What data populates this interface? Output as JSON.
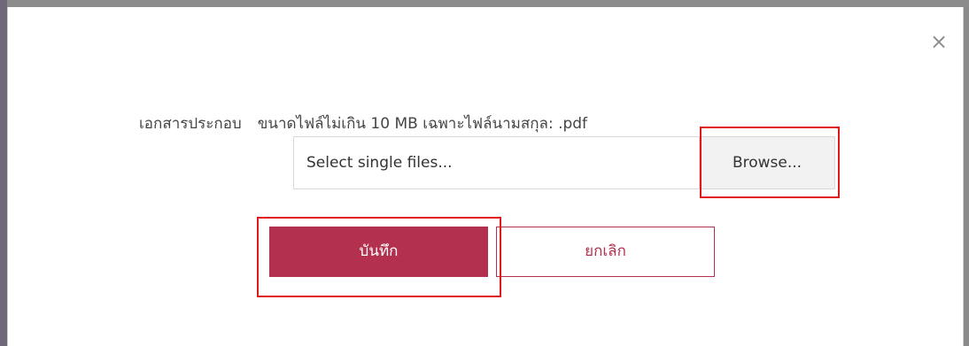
{
  "dialog": {
    "close_icon": "close-icon",
    "close_glyph": "×"
  },
  "upload": {
    "label": "เอกสารประกอบ",
    "hint": "ขนาดไฟล์ไม่เกิน 10 MB เฉพาะไฟล์นามสกุล: .pdf",
    "input_placeholder": "Select single files...",
    "browse_label": "Browse..."
  },
  "actions": {
    "save_label": "บันทึก",
    "cancel_label": "ยกเลิก"
  },
  "colors": {
    "primary": "#b3304e",
    "highlight": "#e0171c"
  }
}
